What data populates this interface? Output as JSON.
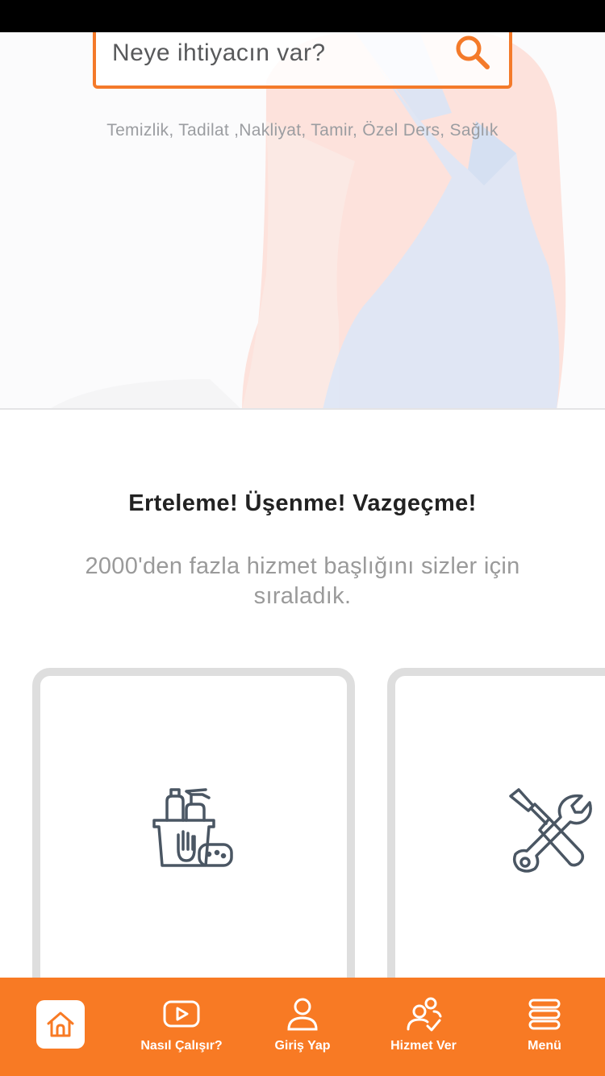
{
  "search": {
    "placeholder": "Neye ihtiyacın var?",
    "icon": "search-icon"
  },
  "quick_categories": "Temizlik, Tadilat ,Nakliyat, Tamir, Özel Ders, Sağlık",
  "tagline": "Erteleme! Üşenme! Vazgeçme!",
  "subtitle": "2000'den fazla hizmet başlığını sizler için sıraladık.",
  "cards": [
    {
      "icon": "cleaning-supplies-icon"
    },
    {
      "icon": "tools-icon"
    }
  ],
  "nav": {
    "items": [
      {
        "icon": "home-icon",
        "label": ""
      },
      {
        "icon": "video-play-icon",
        "label": "Nasıl Çalışır?"
      },
      {
        "icon": "user-icon",
        "label": "Giriş Yap"
      },
      {
        "icon": "user-check-icon",
        "label": "Hizmet Ver"
      },
      {
        "icon": "menu-icon",
        "label": "Menü"
      }
    ]
  },
  "colors": {
    "accent": "#f87a24",
    "card_border": "#dedede",
    "icon_gray": "#4a5663"
  }
}
